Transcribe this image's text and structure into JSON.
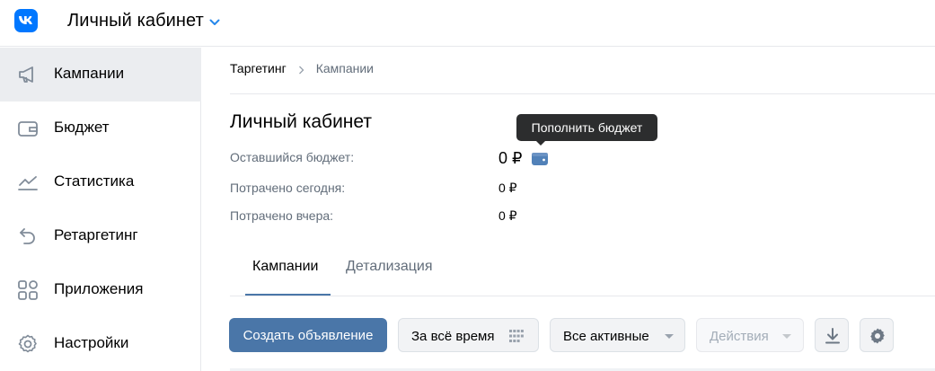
{
  "header": {
    "title": "Личный кабинет",
    "logo_icon": "vk-logo-icon",
    "chevron_icon": "chevron-down-icon"
  },
  "sidebar": {
    "items": [
      {
        "label": "Кампании",
        "icon": "megaphone-icon",
        "active": true
      },
      {
        "label": "Бюджет",
        "icon": "wallet-icon",
        "active": false
      },
      {
        "label": "Статистика",
        "icon": "chart-icon",
        "active": false
      },
      {
        "label": "Ретаргетинг",
        "icon": "retarget-icon",
        "active": false
      },
      {
        "label": "Приложения",
        "icon": "apps-icon",
        "active": false
      },
      {
        "label": "Настройки",
        "icon": "gear-icon",
        "active": false
      }
    ]
  },
  "breadcrumb": {
    "items": [
      "Таргетинг",
      "Кампании"
    ]
  },
  "account": {
    "title": "Личный кабинет",
    "remaining_label": "Оставшийся бюджет:",
    "remaining_value": "0 ₽",
    "spent_today_label": "Потрачено сегодня:",
    "spent_today_value": "0 ₽",
    "spent_yesterday_label": "Потрачено вчера:",
    "spent_yesterday_value": "0 ₽",
    "topup_tooltip": "Пополнить бюджет"
  },
  "tabs": [
    {
      "label": "Кампании",
      "active": true
    },
    {
      "label": "Детализация",
      "active": false
    }
  ],
  "toolbar": {
    "create_label": "Создать объявление",
    "period_label": "За всё время",
    "filter_label": "Все активные",
    "actions_label": "Действия",
    "download_icon": "download-icon",
    "settings_icon": "gear-icon"
  },
  "colors": {
    "accent": "#4a76a8",
    "vk_blue": "#0077ff",
    "sidebar_active": "#ebedf0",
    "muted_text": "#626d7a",
    "tooltip_bg": "#2c2d2e"
  }
}
